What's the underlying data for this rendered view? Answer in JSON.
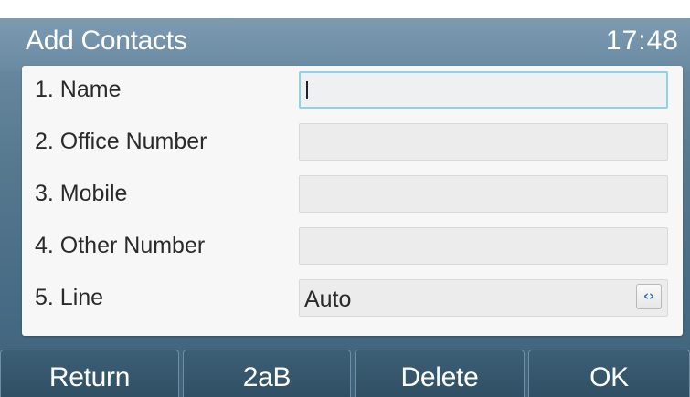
{
  "header": {
    "title": "Add Contacts",
    "clock": "17:48"
  },
  "form": {
    "rows": [
      {
        "label": "1. Name",
        "value": ""
      },
      {
        "label": "2.  Office Number",
        "value": ""
      },
      {
        "label": "3. Mobile",
        "value": ""
      },
      {
        "label": "4. Other Number",
        "value": ""
      },
      {
        "label": "5. Line",
        "value": "Auto",
        "switch_icon": "left-right-arrows-icon"
      }
    ]
  },
  "softkeys": {
    "return_label": "Return",
    "input_mode_label": "2aB",
    "delete_label": "Delete",
    "ok_label": "OK"
  },
  "colors": {
    "title_bar": "#6a8aa2",
    "panel": "#f7f7f7",
    "field": "#ececec",
    "active_field_border": "#8fd0ea",
    "softkey": "#2f4f64"
  }
}
